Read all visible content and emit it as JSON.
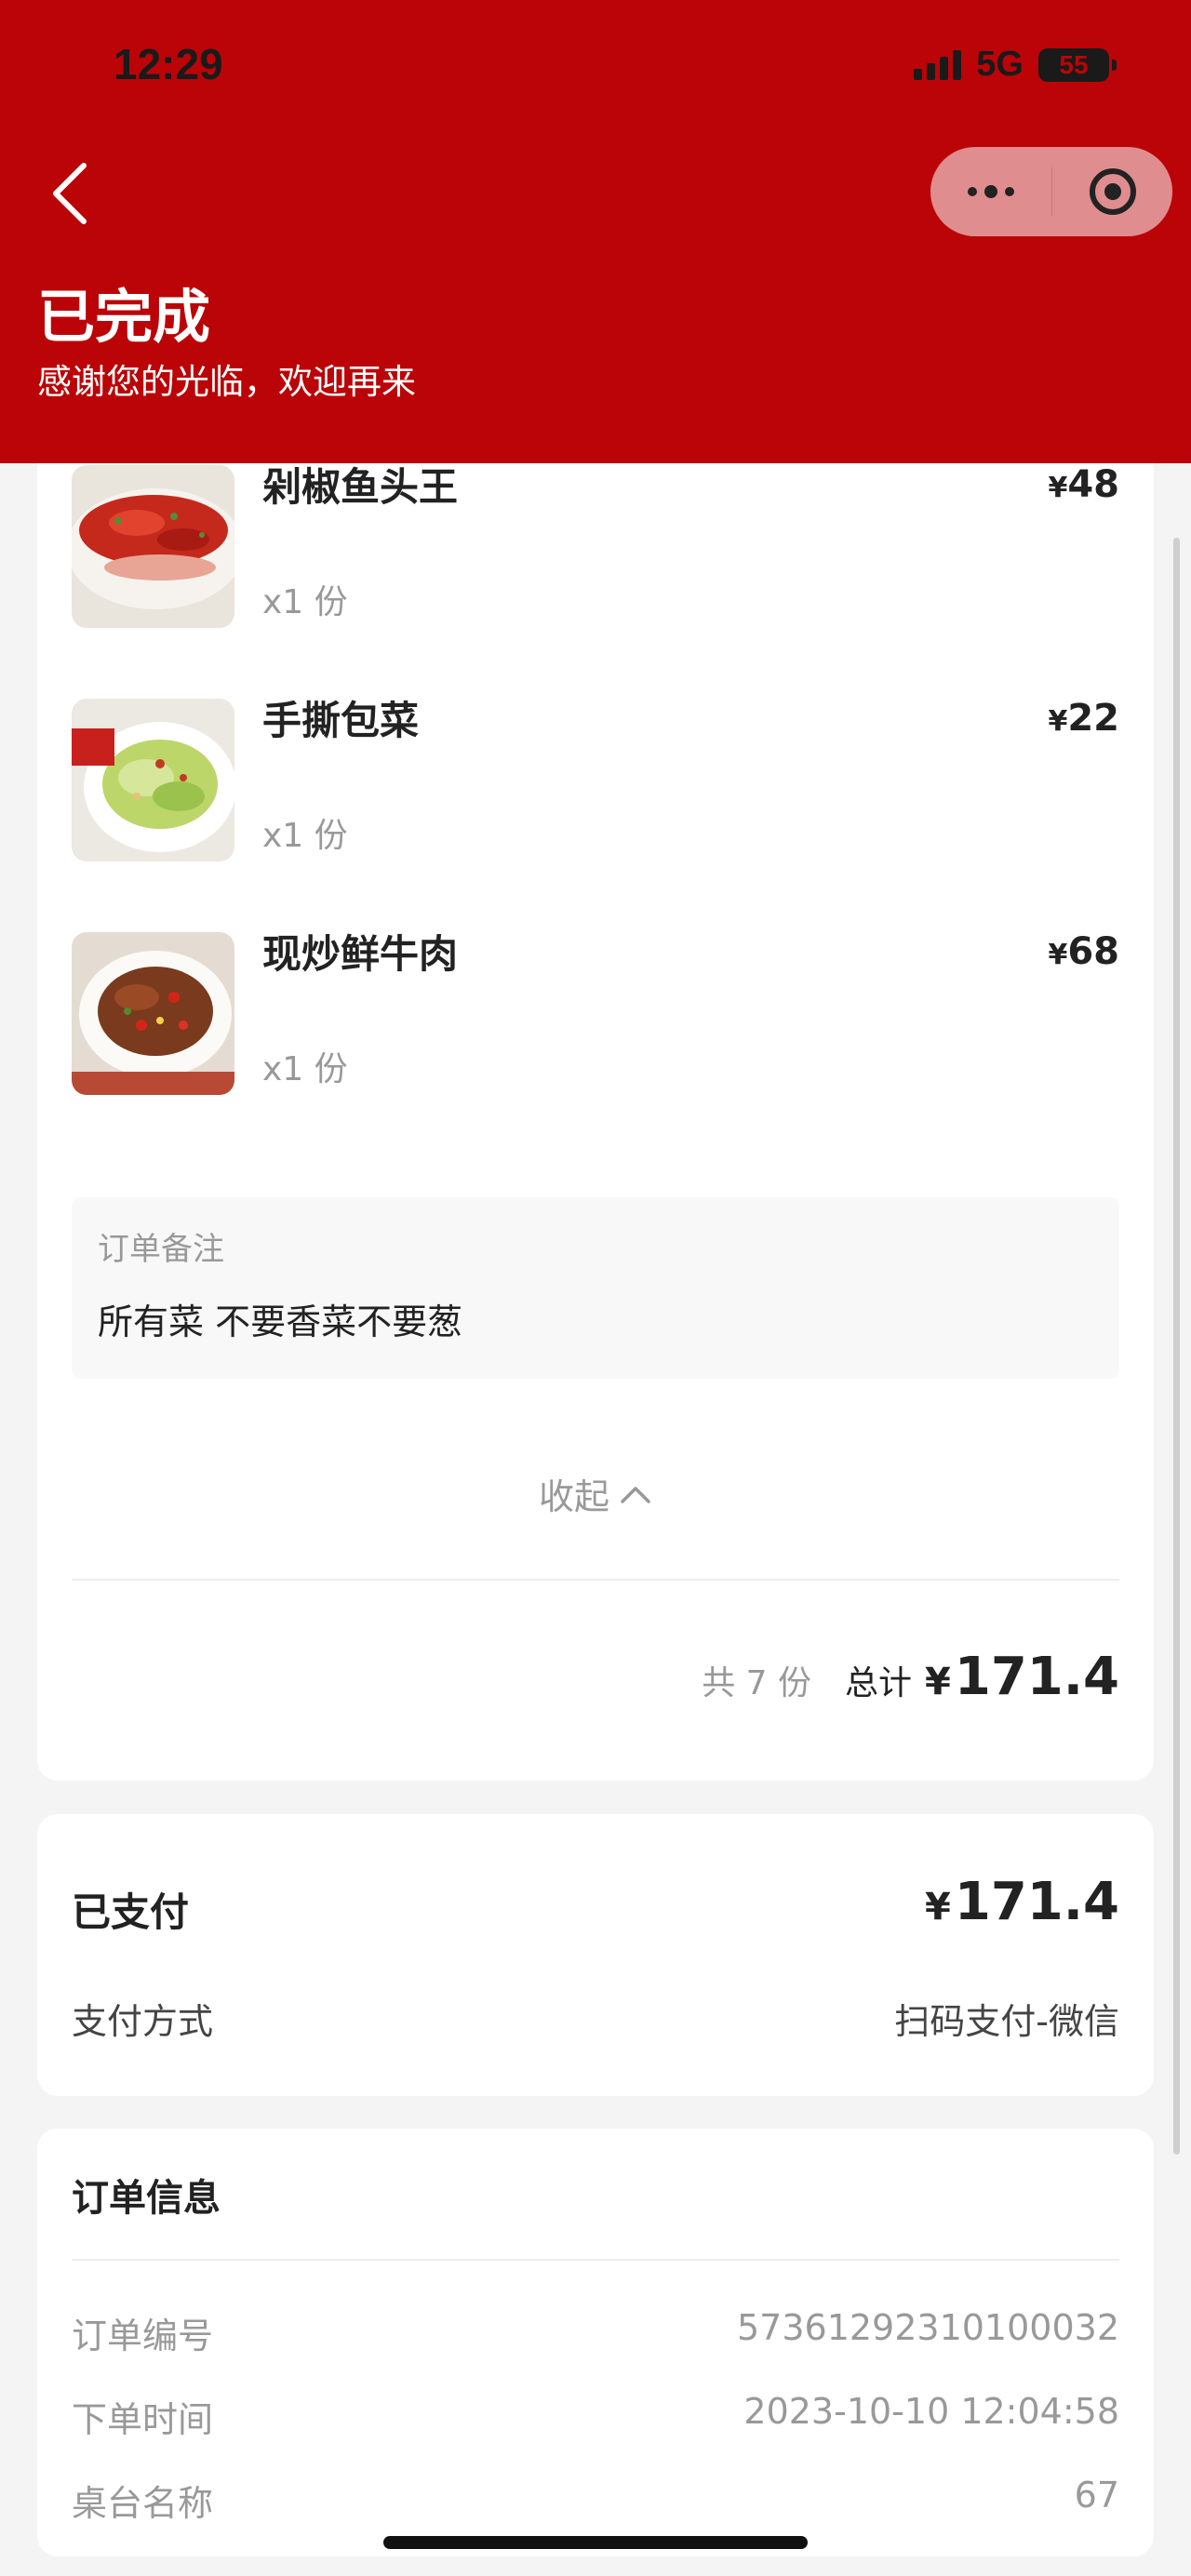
{
  "status_bar": {
    "time": "12:29",
    "network": "5G",
    "battery": "55"
  },
  "header": {
    "title": "已完成",
    "subtitle": "感谢您的光临，欢迎再来"
  },
  "items": [
    {
      "name": "剁椒鱼头王",
      "price_currency": "¥",
      "price": "48",
      "qty": "x1 份"
    },
    {
      "name": "手撕包菜",
      "price_currency": "¥",
      "price": "22",
      "qty": "x1 份"
    },
    {
      "name": "现炒鲜牛肉",
      "price_currency": "¥",
      "price": "68",
      "qty": "x1 份"
    }
  ],
  "note": {
    "label": "订单备注",
    "text": "所有菜 不要香菜不要葱"
  },
  "collapse_label": "收起",
  "summary": {
    "count": "共 7 份",
    "total_label": "总计",
    "currency": "¥",
    "total": "171.4"
  },
  "payment": {
    "status": "已支付",
    "currency": "¥",
    "amount": "171.4",
    "method_label": "支付方式",
    "method_value": "扫码支付-微信"
  },
  "order_info": {
    "title": "订单信息",
    "rows": [
      {
        "label": "订单编号",
        "value": "57361292310100032"
      },
      {
        "label": "下单时间",
        "value": "2023-10-10 12:04:58"
      },
      {
        "label": "桌台名称",
        "value": "67"
      }
    ]
  },
  "colors": {
    "brand": "#bb0407",
    "page_bg": "#f4f4f4"
  }
}
